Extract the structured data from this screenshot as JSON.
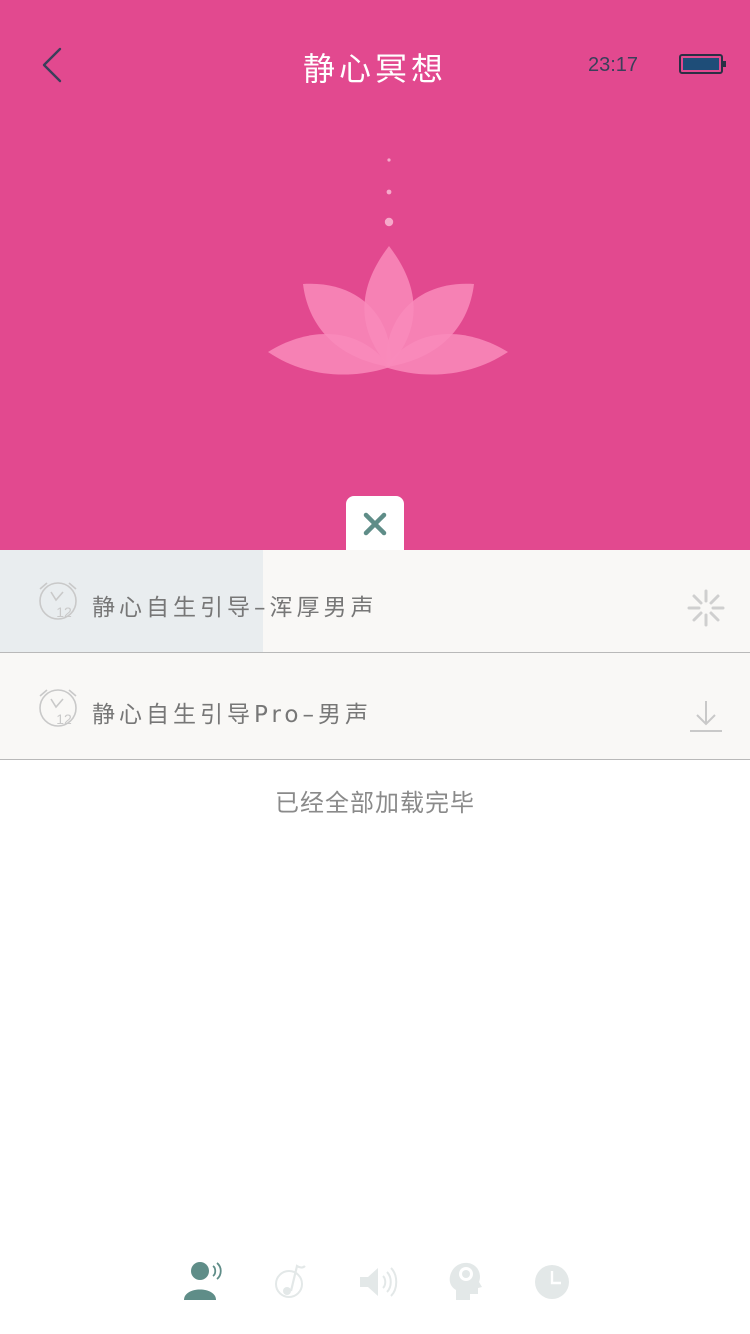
{
  "header": {
    "title": "静心冥想",
    "time": "23:17",
    "battery_color": "#1e4d78"
  },
  "theme": {
    "primary": "#e2498f",
    "lotus": "#f98bbb",
    "accent": "#5f8d88"
  },
  "tracks": [
    {
      "title": "静心自生引导–浑厚男声",
      "icon": "alarm-clock-icon",
      "action": "loading-spinner-icon",
      "progress": 0.35
    },
    {
      "title": "静心自生引导Pro–男声",
      "icon": "alarm-clock-icon",
      "action": "download-icon",
      "progress": 0
    }
  ],
  "status": {
    "loaded_message": "已经全部加载完毕"
  },
  "bottom_nav": [
    {
      "icon": "person-voice-icon",
      "active": true
    },
    {
      "icon": "music-note-icon",
      "active": false
    },
    {
      "icon": "speaker-icon",
      "active": false
    },
    {
      "icon": "head-profile-icon",
      "active": false
    },
    {
      "icon": "clock-icon",
      "active": false
    }
  ]
}
